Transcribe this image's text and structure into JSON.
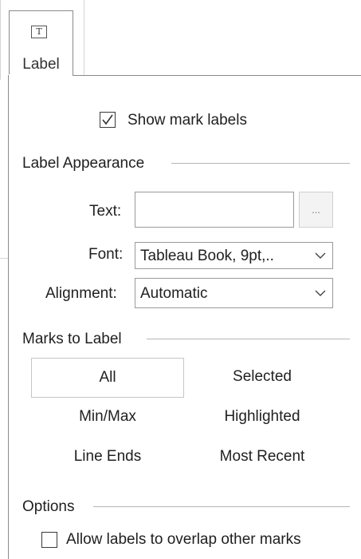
{
  "toolbar": {
    "label_button": "Label",
    "label_icon": "T"
  },
  "panel": {
    "show_mark_labels": {
      "label": "Show mark labels",
      "checked": true
    },
    "label_appearance": {
      "heading": "Label Appearance",
      "text_label": "Text:",
      "text_value": "",
      "text_more_button": "...",
      "font_label": "Font:",
      "font_value": "Tableau Book, 9pt,..",
      "alignment_label": "Alignment:",
      "alignment_value": "Automatic"
    },
    "marks_to_label": {
      "heading": "Marks to Label",
      "options": [
        "All",
        "Selected",
        "Min/Max",
        "Highlighted",
        "Line Ends",
        "Most Recent"
      ],
      "selected": "All"
    },
    "options": {
      "heading": "Options",
      "allow_overlap": {
        "label": "Allow labels to overlap other marks",
        "checked": false
      }
    }
  }
}
